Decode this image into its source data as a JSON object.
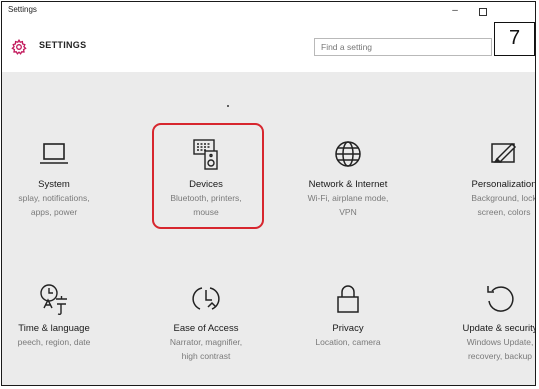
{
  "window": {
    "title": "Settings",
    "minimize_label": "–"
  },
  "header": {
    "title": "SETTINGS",
    "search_placeholder": "Find a setting"
  },
  "step_badge": "7",
  "accent_color": "#c2185b",
  "highlight_color": "#d7262e",
  "tiles": [
    {
      "icon": "laptop-icon",
      "title": "System",
      "desc": [
        "splay, notifications,",
        "apps, power"
      ]
    },
    {
      "icon": "devices-icon",
      "title": "Devices",
      "desc": [
        "Bluetooth, printers,",
        "mouse"
      ]
    },
    {
      "icon": "globe-icon",
      "title": "Network & Internet",
      "desc": [
        "Wi-Fi, airplane mode,",
        "VPN"
      ]
    },
    {
      "icon": "personalization-icon",
      "title": "Personalization",
      "desc": [
        "Background, lock",
        "screen, colors"
      ]
    },
    {
      "icon": "time-language-icon",
      "title": "Time & language",
      "desc": [
        "peech, region, date",
        ""
      ]
    },
    {
      "icon": "ease-of-access-icon",
      "title": "Ease of Access",
      "desc": [
        "Narrator, magnifier,",
        "high contrast"
      ]
    },
    {
      "icon": "lock-icon",
      "title": "Privacy",
      "desc": [
        "Location, camera",
        ""
      ]
    },
    {
      "icon": "update-icon",
      "title": "Update & security",
      "desc": [
        "Windows Update,",
        "recovery, backup"
      ]
    }
  ]
}
